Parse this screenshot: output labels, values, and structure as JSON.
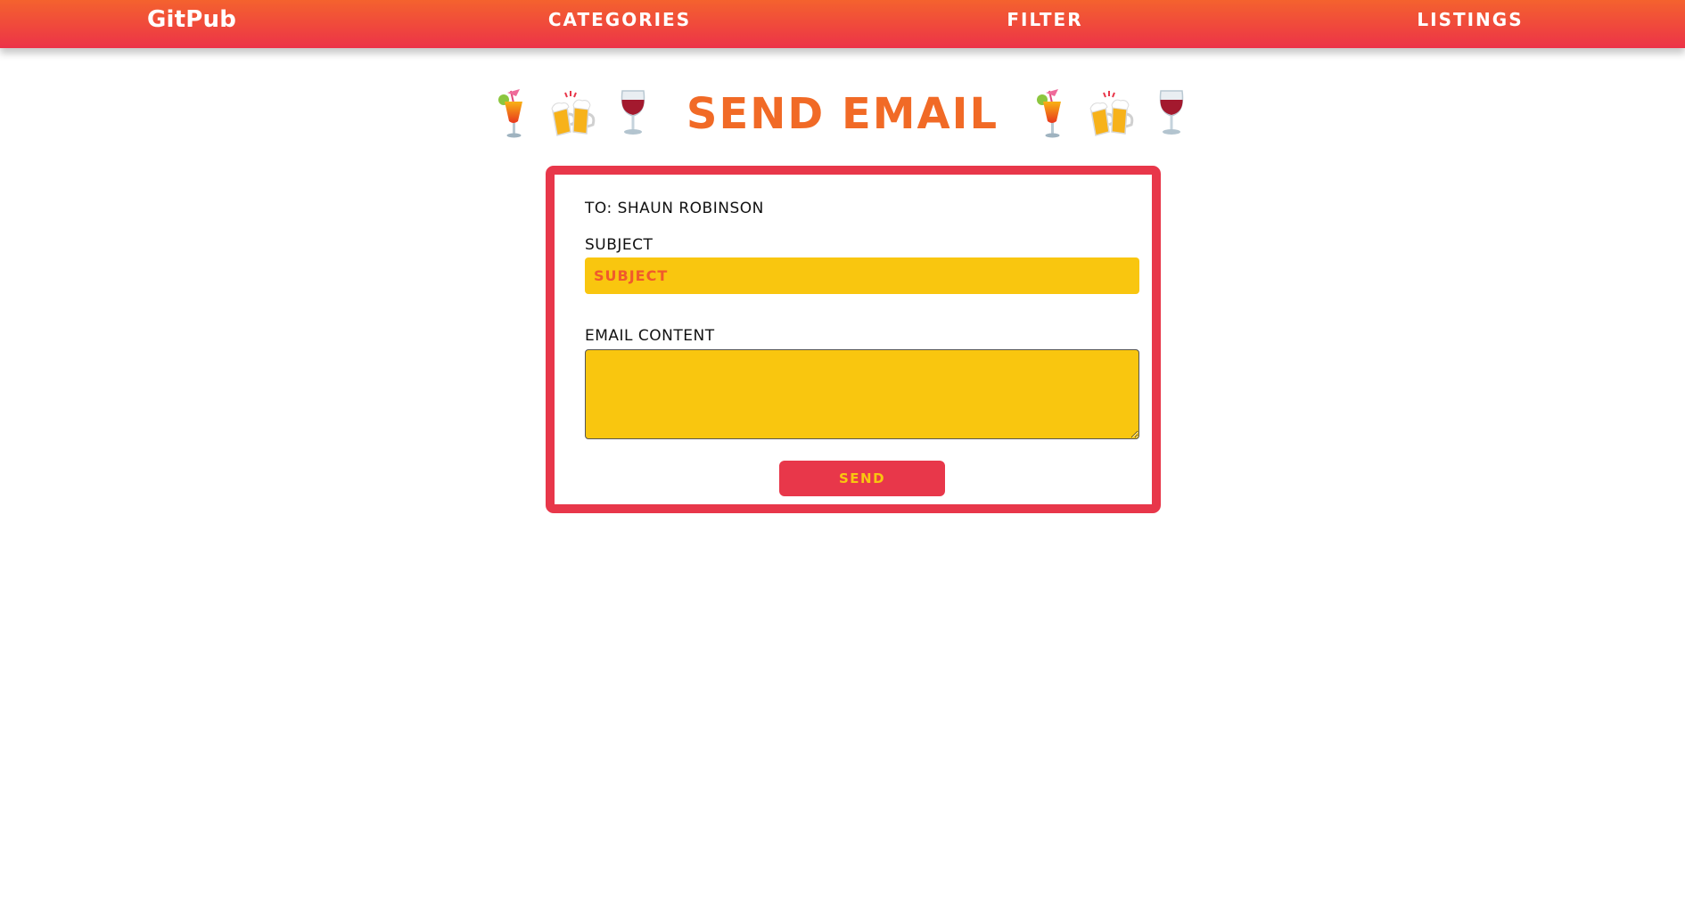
{
  "navbar": {
    "brand": "GitPub",
    "items": [
      {
        "label": "CATEGORIES"
      },
      {
        "label": "FILTER"
      },
      {
        "label": "LISTINGS"
      }
    ]
  },
  "page": {
    "title": "SEND EMAIL",
    "decor_icons": [
      "tropical-drink-icon",
      "clinking-beer-mugs-icon",
      "wine-glass-icon"
    ]
  },
  "email_form": {
    "to_line": "TO: SHAUN ROBINSON",
    "subject_label": "SUBJECT",
    "subject_placeholder": "SUBJECT",
    "subject_value": "",
    "content_label": "EMAIL CONTENT",
    "content_value": "",
    "send_label": "SEND"
  },
  "colors": {
    "nav_gradient_top": "#f4622e",
    "nav_gradient_bottom": "#ec3348",
    "title": "#f16a26",
    "card_border": "#e8374a",
    "field_bg": "#f9c60f",
    "button_bg": "#e8374a",
    "button_text": "#f9c60f"
  }
}
